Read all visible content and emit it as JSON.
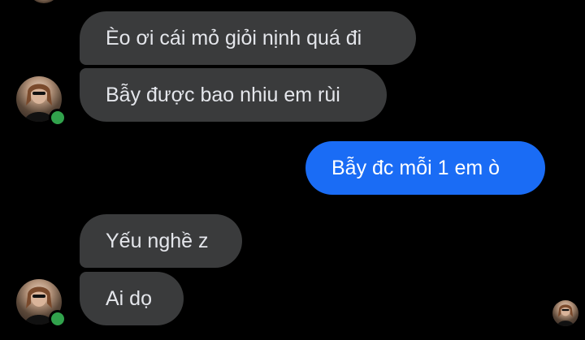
{
  "conversation": {
    "messages": [
      {
        "sender": "other",
        "text": "Èo ơi cái mỏ giỏi nịnh quá đi"
      },
      {
        "sender": "other",
        "text": "Bẫy được bao nhiu em rùi"
      },
      {
        "sender": "me",
        "text": "Bẫy đc mỗi 1 em ò"
      },
      {
        "sender": "other",
        "text": "Yếu nghề z"
      },
      {
        "sender": "other",
        "text": "Ai dọ"
      }
    ]
  },
  "contact": {
    "online_status_color": "#31a24c"
  },
  "colors": {
    "background": "#000000",
    "incoming_bubble": "#3a3b3c",
    "outgoing_bubble": "#1a6cf5"
  }
}
